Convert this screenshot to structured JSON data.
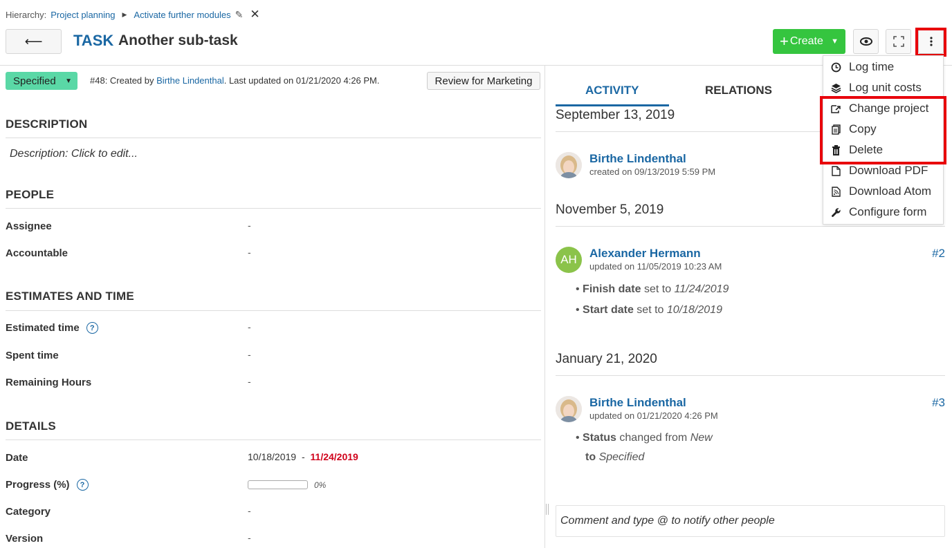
{
  "breadcrumb": {
    "label": "Hierarchy:",
    "items": [
      "Project planning",
      "Activate further modules"
    ]
  },
  "header": {
    "type": "TASK",
    "subject": "Another sub-task",
    "create_label": "Create"
  },
  "status": {
    "value": "Specified",
    "meta_prefix": "#48: Created by",
    "author": "Birthe Lindenthal",
    "meta_suffix": ". Last updated on 01/21/2020 4:26 PM.",
    "review_button": "Review for Marketing"
  },
  "sections": {
    "description": "DESCRIPTION",
    "description_placeholder": "Description: Click to edit...",
    "people": "PEOPLE",
    "estimates": "ESTIMATES AND TIME",
    "details": "DETAILS"
  },
  "fields": {
    "assignee": {
      "label": "Assignee",
      "value": "-"
    },
    "accountable": {
      "label": "Accountable",
      "value": "-"
    },
    "estimated": {
      "label": "Estimated time",
      "value": "-"
    },
    "spent": {
      "label": "Spent time",
      "value": "-"
    },
    "remaining": {
      "label": "Remaining Hours",
      "value": "-"
    },
    "date": {
      "label": "Date",
      "start": "10/18/2019",
      "sep": "-",
      "end": "11/24/2019"
    },
    "progress": {
      "label": "Progress (%)",
      "value": "0%",
      "fraction": 0
    },
    "category": {
      "label": "Category",
      "value": "-"
    },
    "version": {
      "label": "Version",
      "value": "-"
    }
  },
  "tabs": [
    "ACTIVITY",
    "RELATIONS"
  ],
  "activity": {
    "days": [
      "September 13, 2019",
      "November 5, 2019",
      "January 21, 2020"
    ],
    "entries": [
      {
        "user": "Birthe Lindenthal",
        "meta": "created on 09/13/2019 5:59 PM"
      },
      {
        "user": "Alexander Hermann",
        "initials": "AH",
        "meta": "updated on 11/05/2019 10:23 AM",
        "number": "#2",
        "details": [
          {
            "field": "Finish date",
            "text": "set to",
            "value": "11/24/2019"
          },
          {
            "field": "Start date",
            "text": "set to",
            "value": "10/18/2019"
          }
        ]
      },
      {
        "user": "Birthe Lindenthal",
        "meta": "updated on 01/21/2020 4:26 PM",
        "number": "#3",
        "details": [
          {
            "field": "Status",
            "text": "changed from",
            "value": "New",
            "text2": "to",
            "value2": "Specified"
          }
        ]
      }
    ],
    "comment_placeholder": "Comment and type @ to notify other people"
  },
  "menu": {
    "items": [
      "Log time",
      "Log unit costs",
      "Change project",
      "Copy",
      "Delete",
      "Download PDF",
      "Download Atom",
      "Configure form"
    ]
  },
  "colors": {
    "accent": "#1a67a3",
    "create": "#35c53f",
    "status": "#5ad8a6",
    "highlight": "#e8000b",
    "overdue": "#d0021b"
  }
}
